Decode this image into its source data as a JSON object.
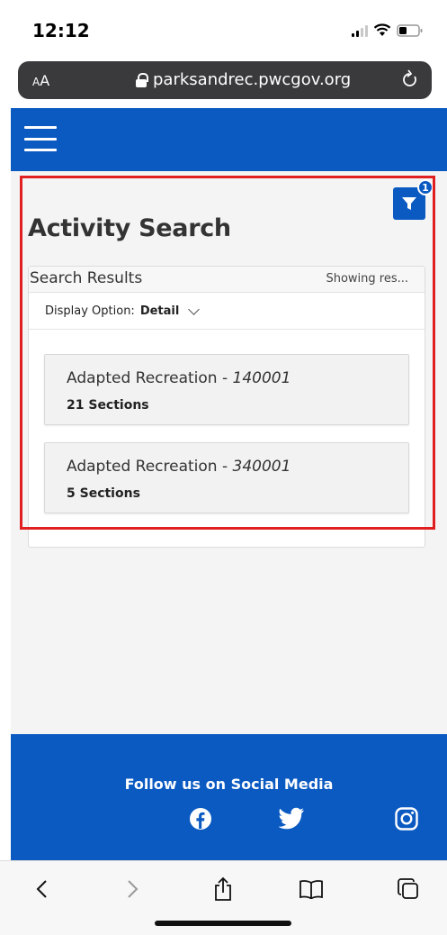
{
  "status_bar": {
    "time": "12:12"
  },
  "browser": {
    "aa_label_small": "A",
    "aa_label_large": "A",
    "url": "parksandrec.pwcgov.org"
  },
  "filter": {
    "badge_count": "1"
  },
  "page": {
    "title": "Activity Search"
  },
  "results": {
    "title": "Search Results",
    "showing": "Showing res...",
    "display_option_label": "Display Option:",
    "display_option_value": "Detail",
    "cards": [
      {
        "name": "Adapted Recreation - ",
        "code": "140001",
        "sections": "21 Sections"
      },
      {
        "name": "Adapted Recreation - ",
        "code": "340001",
        "sections": "5 Sections"
      }
    ]
  },
  "footer": {
    "title": "Follow us on Social Media"
  },
  "icons": {
    "menu": "hamburger-menu-icon",
    "filter": "filter-icon",
    "facebook": "facebook-icon",
    "twitter": "twitter-icon",
    "instagram": "instagram-icon",
    "back": "back-arrow-icon",
    "forward": "forward-arrow-icon",
    "share": "share-icon",
    "bookmarks": "bookmarks-icon",
    "tabs": "tabs-icon"
  },
  "colors": {
    "brand_blue": "#0a5ac2",
    "highlight_red": "#e02020"
  }
}
